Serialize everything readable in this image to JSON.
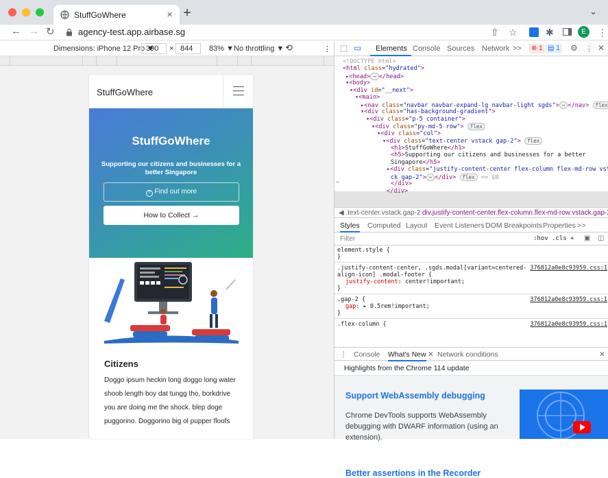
{
  "browser": {
    "tab_title": "StuffGoWhere",
    "tab_close": "×",
    "new_tab": "+",
    "url": "agency-test.app.airbase.sg"
  },
  "device_toolbar": {
    "dimensions_label": "Dimensions: iPhone 12 Pro ▼",
    "width": "390",
    "times": "×",
    "height": "844",
    "zoom": "83% ▼",
    "throttling": "No throttling ▼"
  },
  "phone": {
    "brand": "StuffGoWhere",
    "hero_title": "StuffGoWhere",
    "hero_subtitle": "Supporting our citizens and businesses for a better Singapore",
    "find_out_more": "Find out more",
    "how_to_collect": "How to Collect →",
    "citizens_heading": "Citizens",
    "citizens_text": "Doggo ipsum heckin long doggo long water shoob length boy dat tungg tho, borkdrive you are doing me the shock. blep doge puggorino. Doggorino big ol pupper floofs"
  },
  "devtools": {
    "tabs": [
      "Elements",
      "Console",
      "Sources",
      "Network",
      ">>"
    ],
    "errors": "1",
    "messages": "1",
    "dom": {
      "doctype": "<!DOCTYPE html>",
      "html_class": "hydrated",
      "nav_class": "navbar navbar-expand-lg navbar-light sgds",
      "bg_class": "has-background-gradient",
      "container_class": "p-5 container",
      "row_class": "py-md-5 row",
      "col_class": "col",
      "vstack_class": "text-center vstack gap-2",
      "h1_text": "StuffGoWhere",
      "h5_text_1": "Supporting our citizens and businesses for a better",
      "h5_text_2": "Singapore",
      "selected_class_1": "justify-content-center flex-column flex-md-row vsta",
      "selected_class_2": "ck gap-2",
      "flex": "flex",
      "dollar0": "== $0"
    },
    "crumbs": [
      "◀ .text-center.vstack.gap-2",
      "div.justify-content-center.flex-column.flex-md-row.vstack.gap-2"
    ],
    "subtabs": [
      "Styles",
      "Computed",
      "Layout",
      "Event Listeners",
      "DOM Breakpoints",
      "Properties",
      ">>"
    ],
    "filter_placeholder": "Filter",
    "filter_tools": ":hov  .cls  +",
    "styles": {
      "element_style": "element.style {",
      "close": "}",
      "rule1_selector": ".justify-content-center, .sgds.modal[variant=centered-",
      "rule1_selector2": "align-icon] .modal-footer {",
      "rule1_prop": "justify-content",
      "rule1_val": "center!important;",
      "rule2_selector": ".gap-2 {",
      "rule2_prop": "gap",
      "rule2_val": "▸ 0.5rem!important;",
      "rule3_selector": ".flex-column {",
      "source": "376812a0e8c93959.css:1"
    },
    "drawer_tabs": [
      "Console",
      "What's New",
      "Network conditions"
    ],
    "highlights": "Highlights from the Chrome 114 update",
    "whats_new": {
      "h1": "Support WebAssembly debugging",
      "p": "Chrome DevTools supports WebAssembly debugging with DWARF information (using an extension).",
      "h2": "Better assertions in the Recorder"
    }
  },
  "colors": {
    "accent": "#1a73e8",
    "hero_start": "#4a7ad9",
    "hero_end": "#2cb086"
  }
}
